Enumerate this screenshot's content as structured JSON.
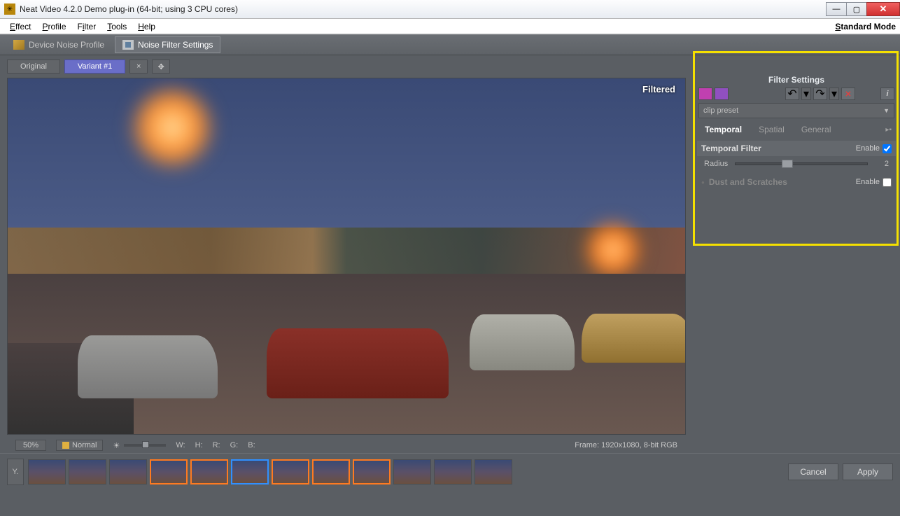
{
  "window": {
    "title": "Neat Video 4.2.0 Demo plug-in (64-bit; using 3 CPU cores)"
  },
  "menu": {
    "effect": "Effect",
    "profile": "Profile",
    "filter": "Filter",
    "tools": "Tools",
    "help": "Help",
    "mode": "Standard Mode"
  },
  "tabs": {
    "profile": "Device Noise Profile",
    "filter": "Noise Filter Settings"
  },
  "toolbar": {
    "original": "Original",
    "variant": "Variant #1"
  },
  "preview": {
    "label": "Filtered"
  },
  "panel": {
    "title": "Filter Settings",
    "preset": "clip preset",
    "tabs": {
      "temporal": "Temporal",
      "spatial": "Spatial",
      "general": "General"
    },
    "temporal_filter": {
      "title": "Temporal Filter",
      "enable_label": "Enable",
      "enabled": true,
      "radius_label": "Radius",
      "radius_value": "2"
    },
    "dust": {
      "title": "Dust and Scratches",
      "enable_label": "Enable",
      "enabled": false
    }
  },
  "status": {
    "zoom": "50%",
    "view_mode": "Normal",
    "w": "W:",
    "h": "H:",
    "r": "R:",
    "g": "G:",
    "b": "B:",
    "frame": "Frame: 1920x1080, 8-bit RGB"
  },
  "footer": {
    "y": "Y.",
    "cancel": "Cancel",
    "apply": "Apply"
  },
  "thumbs": [
    {
      "sel": ""
    },
    {
      "sel": ""
    },
    {
      "sel": ""
    },
    {
      "sel": "orange"
    },
    {
      "sel": "orange"
    },
    {
      "sel": "blue"
    },
    {
      "sel": "orange"
    },
    {
      "sel": "orange"
    },
    {
      "sel": "orange"
    },
    {
      "sel": ""
    },
    {
      "sel": ""
    },
    {
      "sel": ""
    }
  ]
}
